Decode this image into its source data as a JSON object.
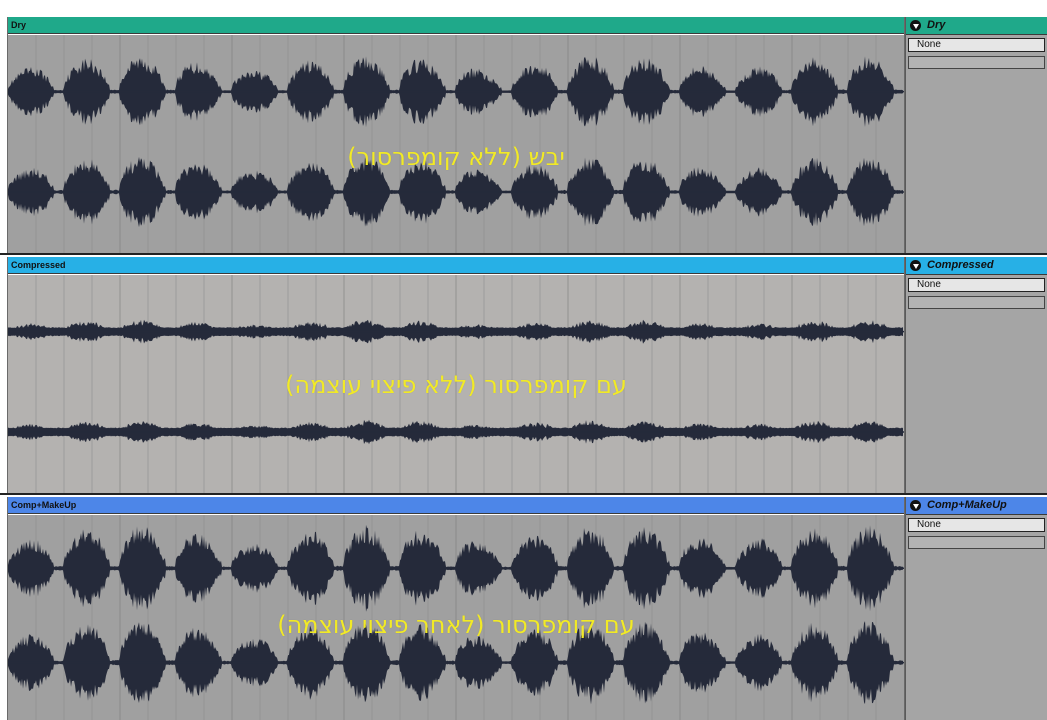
{
  "tracks": [
    {
      "name": "Dry",
      "header_color": "#1fa98a",
      "body_color": "#a0a0a0",
      "overlay": "יבש (ללא קומפרסור)",
      "dropdown_value": "None",
      "amplitude": 1.0
    },
    {
      "name": "Compressed",
      "header_color": "#27b0e6",
      "body_color": "#b4b2b0",
      "overlay": "עם קומפרסור (ללא פיצוי עוצמה)",
      "dropdown_value": "None",
      "amplitude": 0.35
    },
    {
      "name": "Comp+MakeUp",
      "header_color": "#4d86e8",
      "body_color": "#a0a0a0",
      "overlay": "עם קומפרסור (לאחר פיצוי עוצמה)",
      "dropdown_value": "None",
      "amplitude": 1.25
    }
  ],
  "colors": {
    "waveform": "#252a3a",
    "overlay_text": "#f2ea26"
  },
  "icons": {
    "fold": "fold-triangle-icon"
  }
}
